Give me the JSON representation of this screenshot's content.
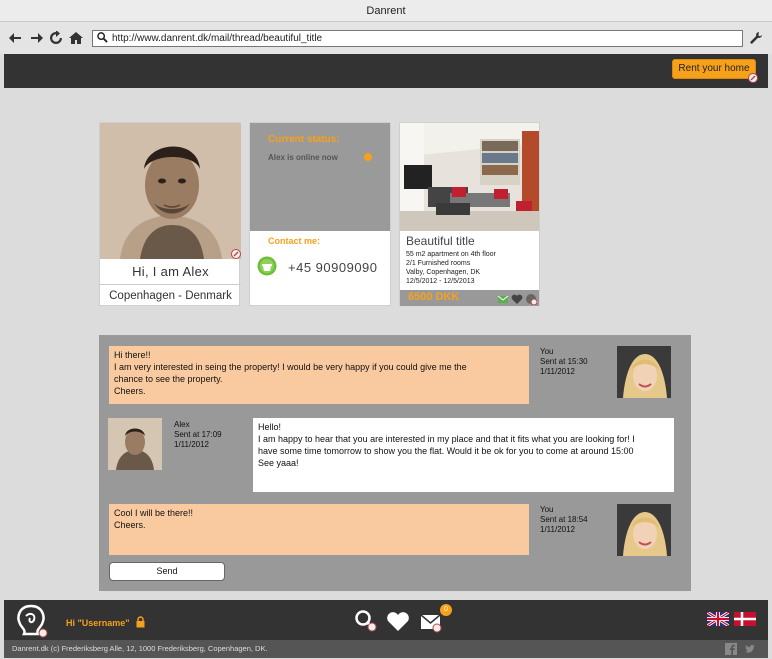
{
  "window": {
    "title": "Danrent"
  },
  "browser": {
    "url": "http://www.danrent.dk/mail/thread/beautiful_title"
  },
  "header": {
    "rent_button": "Rent your home"
  },
  "profile": {
    "greeting": "Hi, I am Alex",
    "location": "Copenhagen - Denmark"
  },
  "status": {
    "title": "Current status:",
    "text": "Alex is online now",
    "contact_title": "Contact me:",
    "phone": "+45 90909090"
  },
  "listing": {
    "title": "Beautiful title",
    "details": [
      "55 m2 apartment on 4th floor",
      "2/1 Furnished rooms",
      "Valby, Copenhagen, DK",
      "12/5/2012 - 12/5/2013"
    ],
    "price": "6500 DKK"
  },
  "messages": [
    {
      "lines": [
        "Hi there!!",
        "I am very interested in seing the property! I would be very happy if you could give me the",
        "chance to see the property.",
        "Cheers."
      ],
      "sender": "You",
      "sent": "Sent at 15:30",
      "date": "1/11/2012"
    },
    {
      "lines": [
        "Hello!",
        "I am happy to hear that you are interested in my place and that it fits what you are looking for! I",
        "have some time tomorrow to show you the flat. Would it be ok for you to come at around 15:00",
        "See yaaa!"
      ],
      "sender": "Alex",
      "sent": "Sent at 17:09",
      "date": "1/11/2012"
    },
    {
      "lines": [
        "Cool I will be there!!",
        "Cheers."
      ],
      "sender": "You",
      "sent": "Sent at 18:54",
      "date": "1/11/2012"
    }
  ],
  "send_button": "Send",
  "footer": {
    "greeting": "Hi \"Username\"",
    "mail_badge": "0",
    "copyright": "Danrent.dk (c) Frederiksberg Alle, 12, 1000 Frederiksberg, Copenhagen, DK."
  },
  "colors": {
    "accent": "#f7a11a",
    "dark": "#333333",
    "bubble_mine": "#f9caa0",
    "panel": "#999999"
  },
  "icons": [
    "back-icon",
    "forward-icon",
    "reload-icon",
    "home-icon",
    "search-icon",
    "wrench-icon",
    "phone-icon",
    "mail-icon",
    "heart-icon",
    "share-icon",
    "lock-icon",
    "search-user-icon",
    "favorites-icon",
    "inbox-icon",
    "flag-uk-icon",
    "flag-dk-icon",
    "facebook-icon",
    "twitter-icon"
  ]
}
